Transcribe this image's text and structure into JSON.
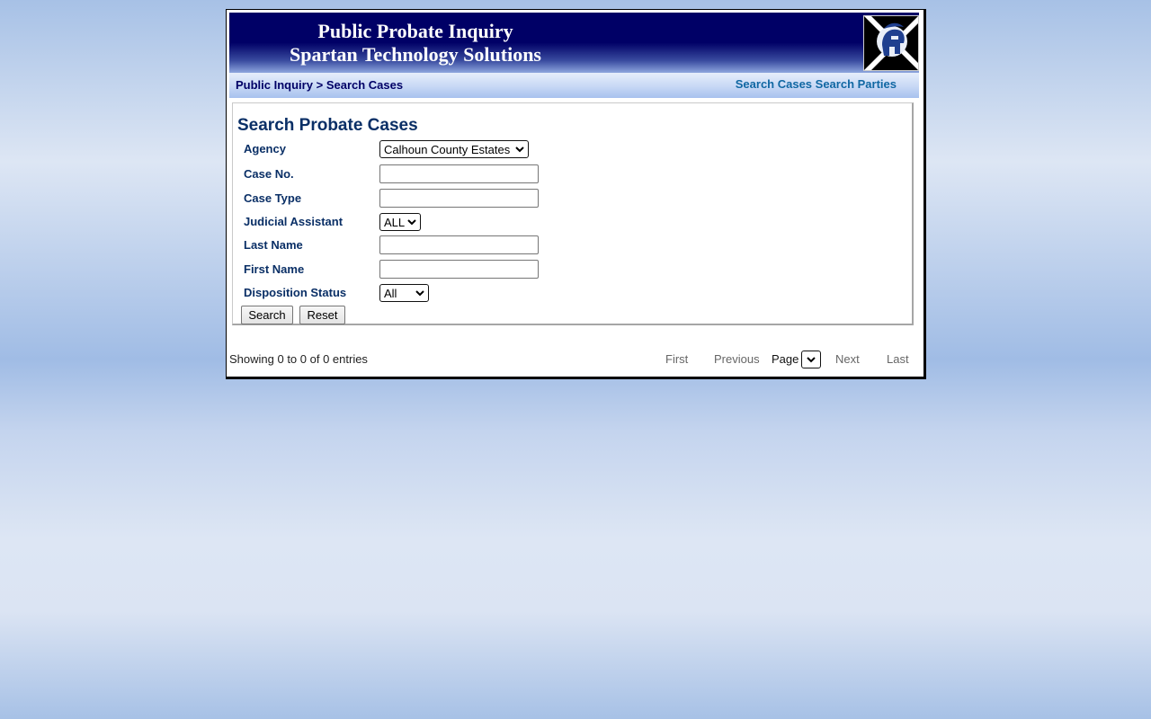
{
  "banner": {
    "title_line1": "Public Probate Inquiry",
    "title_line2": "Spartan Technology Solutions",
    "logo_icon": "spartan-helmet-logo"
  },
  "navbar": {
    "breadcrumb_root": "Public Inquiry",
    "breadcrumb_sep": ">",
    "breadcrumb_current": "Search Cases",
    "links": [
      "Search Cases",
      "Search Parties"
    ]
  },
  "form": {
    "title": "Search Probate Cases",
    "agency_label": "Agency",
    "agency_value": "Calhoun County Estates",
    "case_no_label": "Case No.",
    "case_no_value": "",
    "case_type_label": "Case Type",
    "case_type_value": "",
    "judicial_assistant_label": "Judicial Assistant",
    "judicial_assistant_value": "ALL",
    "last_name_label": "Last Name",
    "last_name_value": "",
    "first_name_label": "First Name",
    "first_name_value": "",
    "disposition_status_label": "Disposition Status",
    "disposition_status_value": "All",
    "search_label": "Search",
    "reset_label": "Reset"
  },
  "pager": {
    "showing": "Showing 0 to 0 of 0 entries",
    "first": "First",
    "previous": "Previous",
    "page_label": "Page",
    "next": "Next",
    "last": "Last"
  },
  "colors": {
    "banner_navy": "#000066",
    "label_navy": "#0a2f66",
    "nav_link": "#1067a3"
  }
}
